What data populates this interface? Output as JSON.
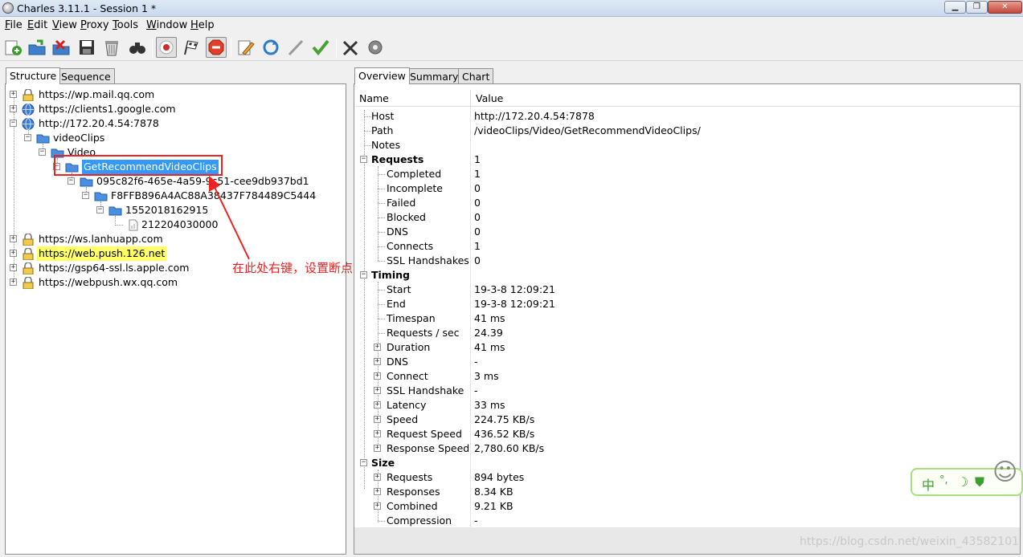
{
  "window": {
    "title": "Charles 3.11.1 - Session 1 *"
  },
  "menu": [
    {
      "key": "F",
      "rest": "ile"
    },
    {
      "key": "E",
      "rest": "dit"
    },
    {
      "key": "V",
      "rest": "iew"
    },
    {
      "key": "P",
      "rest": "roxy"
    },
    {
      "key": "T",
      "rest": "ools"
    },
    {
      "key": "W",
      "rest": "indow"
    },
    {
      "key": "H",
      "rest": "elp"
    }
  ],
  "toolbar_icons": [
    "new-session-icon",
    "open-session-icon",
    "close-session-icon",
    "save-session-icon",
    "clear-session-icon",
    "find-icon",
    "record-icon",
    "throttle-icon",
    "breakpoints-icon",
    "edit-icon",
    "repeat-icon",
    "validate-icon",
    "check-icon",
    "tools-icon",
    "settings-icon"
  ],
  "left_tabs": {
    "structure": "Structure",
    "sequence": "Sequence"
  },
  "tree": [
    {
      "label": "https://wp.mail.qq.com",
      "icon": "lock-icon"
    },
    {
      "label": "https://clients1.google.com",
      "icon": "globe-icon"
    },
    {
      "label": "http://172.20.4.54:7878",
      "icon": "globe-icon"
    },
    {
      "label": "videoClips",
      "icon": "folder-icon"
    },
    {
      "label": "Video",
      "icon": "folder-icon"
    },
    {
      "label": "GetRecommendVideoClips",
      "icon": "folder-icon"
    },
    {
      "label": "095c82f6-465e-4a59-9c51-cee9db937bd1",
      "icon": "folder-icon"
    },
    {
      "label": "F8FFB896A4AC88A38437F784489C5444",
      "icon": "folder-icon"
    },
    {
      "label": "1552018162915",
      "icon": "folder-icon"
    },
    {
      "label": "212204030000",
      "icon": "file-icon"
    },
    {
      "label": "https://ws.lanhuapp.com",
      "icon": "lock-icon"
    },
    {
      "label": "https://web.push.126.net",
      "icon": "lock-icon"
    },
    {
      "label": "https://gsp64-ssl.ls.apple.com",
      "icon": "lock-icon"
    },
    {
      "label": "https://webpush.wx.qq.com",
      "icon": "lock-icon"
    }
  ],
  "annotation": "在此处右键，设置断点",
  "right_tabs": {
    "overview": "Overview",
    "summary": "Summary",
    "chart": "Chart"
  },
  "columns": {
    "name": "Name",
    "value": "Value"
  },
  "overview": [
    {
      "name": "Host",
      "value": "http://172.20.4.54:7878"
    },
    {
      "name": "Path",
      "value": "/videoClips/Video/GetRecommendVideoClips/"
    },
    {
      "name": "Notes",
      "value": ""
    },
    {
      "name": "Requests",
      "value": "1"
    },
    {
      "name": "Completed",
      "value": "1"
    },
    {
      "name": "Incomplete",
      "value": "0"
    },
    {
      "name": "Failed",
      "value": "0"
    },
    {
      "name": "Blocked",
      "value": "0"
    },
    {
      "name": "DNS",
      "value": "0"
    },
    {
      "name": "Connects",
      "value": "1"
    },
    {
      "name": "SSL Handshakes",
      "value": "0"
    },
    {
      "name": "Timing",
      "value": ""
    },
    {
      "name": "Start",
      "value": "19-3-8 12:09:21"
    },
    {
      "name": "End",
      "value": "19-3-8 12:09:21"
    },
    {
      "name": "Timespan",
      "value": "41 ms"
    },
    {
      "name": "Requests / sec",
      "value": "24.39"
    },
    {
      "name": "Duration",
      "value": "41 ms"
    },
    {
      "name": "DNS",
      "value": "-"
    },
    {
      "name": "Connect",
      "value": "3 ms"
    },
    {
      "name": "SSL Handshake",
      "value": "-"
    },
    {
      "name": "Latency",
      "value": "33 ms"
    },
    {
      "name": "Speed",
      "value": "224.75 KB/s"
    },
    {
      "name": "Request Speed",
      "value": "436.52 KB/s"
    },
    {
      "name": "Response Speed",
      "value": "2,780.60 KB/s"
    },
    {
      "name": "Size",
      "value": ""
    },
    {
      "name": "Requests",
      "value": "894 bytes"
    },
    {
      "name": "Responses",
      "value": "8.34 KB"
    },
    {
      "name": "Combined",
      "value": "9.21 KB"
    },
    {
      "name": "Compression",
      "value": "-"
    }
  ],
  "ime": {
    "label": "中"
  },
  "watermark": "https://blog.csdn.net/weixin_43582101"
}
